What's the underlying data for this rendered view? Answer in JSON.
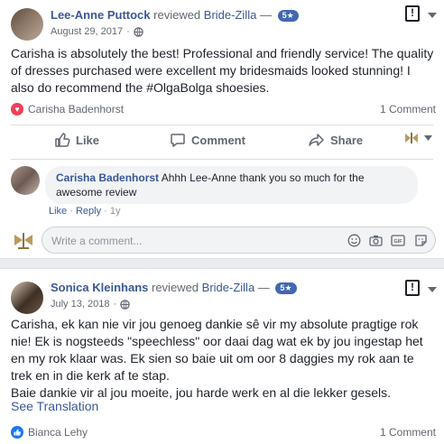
{
  "review1": {
    "reviewer": "Lee-Anne Puttock",
    "verb": "reviewed",
    "page": "Bride-Zilla",
    "dash": "—",
    "rating": "5★",
    "date": "August 29, 2017",
    "dot": "·",
    "text": "Carisha is absolutely the best! Professional and friendly service! The quality of dresses purchased were excellent my bridesmaids looked stunning! I also do recommend the #OlgaBolga shoesies.",
    "reaction_name": "Carisha Badenhorst",
    "comment_count": "1 Comment"
  },
  "actions": {
    "like": "Like",
    "comment": "Comment",
    "share": "Share"
  },
  "reply": {
    "author": "Carisha Badenhorst",
    "text": "Ahhh Lee-Anne thank you so much for the awesome review",
    "like": "Like",
    "reply": "Reply",
    "dot": "·",
    "age": "1y"
  },
  "composer": {
    "placeholder": "Write a comment..."
  },
  "review2": {
    "reviewer": "Sonica Kleinhans",
    "verb": "reviewed",
    "page": "Bride-Zilla",
    "dash": "—",
    "rating": "5★",
    "date": "July 13, 2018",
    "dot": "·",
    "text_lines": [
      "Carisha, ek kan nie vir jou genoeg dankie sê vir my absolute pragtige rok nie! Ek is nogsteeds \"speechless\" oor daai dag wat ek by jou ingestap het en my rok klaar was. Ek sien so baie uit om oor 8 daggies my rok aan te trek en in die kerk af te stap.",
      "Baie dankie vir al jou moeite, jou harde werk en al die lekker gesels."
    ],
    "see_translation": "See Translation",
    "reaction_name": "Bianca Lehy",
    "comment_count": "1 Comment"
  },
  "icons": {
    "report": "!",
    "globe": "globe-icon",
    "heart": "♥"
  },
  "colors": {
    "link": "#385898",
    "badge": "#4267b2",
    "heart": "#f33e58",
    "muted": "#616770"
  }
}
